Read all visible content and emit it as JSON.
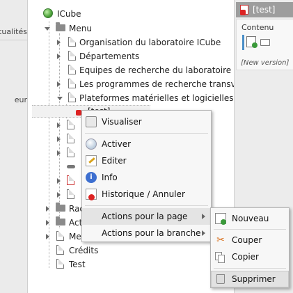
{
  "left_panel": {
    "items": [
      {
        "label": "tualités"
      },
      {
        "label": "eur"
      }
    ]
  },
  "tree": {
    "root_label": "ICube",
    "menu_label": "Menu",
    "menu_children": [
      "Organisation du laboratoire ICube",
      "Départements",
      "Equipes de recherche du laboratoire I",
      "Les programmes de recherche transve",
      "Plateformes matérielles et logicielles"
    ],
    "selected_label": "[test]",
    "bottom_items": [
      "Rac",
      "Act",
      "Me",
      "Crédits",
      "Test"
    ]
  },
  "right_panel": {
    "header_label": "[test]",
    "contenu_label": "Contenu",
    "new_version_label": "[New version]"
  },
  "context_menu": {
    "items": {
      "visualiser": "Visualiser",
      "activer": "Activer",
      "editer": "Editer",
      "info": "Info",
      "historique": "Historique / Annuler",
      "actions_page": "Actions pour la page",
      "actions_branche": "Actions pour la branche"
    }
  },
  "submenu": {
    "items": {
      "nouveau": "Nouveau",
      "couper": "Couper",
      "copier": "Copier",
      "supprimer": "Supprimer"
    }
  },
  "colors": {
    "accent_red": "#d22222",
    "menu_bg": "#f7f7f7",
    "highlight": "#e2e2e2"
  }
}
